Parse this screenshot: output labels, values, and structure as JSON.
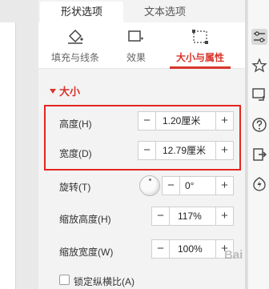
{
  "tabs": {
    "shape_options": "形状选项",
    "text_options": "文本选项"
  },
  "subtabs": {
    "fill_line": "填充与线条",
    "effect": "效果",
    "size_props": "大小与属性"
  },
  "section": {
    "title": "大小"
  },
  "fields": {
    "height": {
      "label": "高度(H)",
      "value": "1.20厘米"
    },
    "width": {
      "label": "宽度(D)",
      "value": "12.79厘米"
    },
    "rotation": {
      "label": "旋转(T)",
      "value": "0°"
    },
    "scale_height": {
      "label": "缩放高度(H)",
      "value": "117%"
    },
    "scale_width": {
      "label": "缩放宽度(W)",
      "value": "100%"
    },
    "lock_aspect": {
      "label": "锁定纵横比(A)",
      "checked": false
    }
  },
  "buttons": {
    "minus": "−",
    "plus": "+"
  },
  "watermark": "Bai",
  "colors": {
    "accent": "#d9342b",
    "highlight_box": "#e5251f",
    "panel_bg": "#f3f3f3"
  },
  "toolbar_icons": [
    "properties-icon",
    "star-effects-icon",
    "transform-icon",
    "help-icon",
    "share-icon",
    "bolt-icon"
  ]
}
